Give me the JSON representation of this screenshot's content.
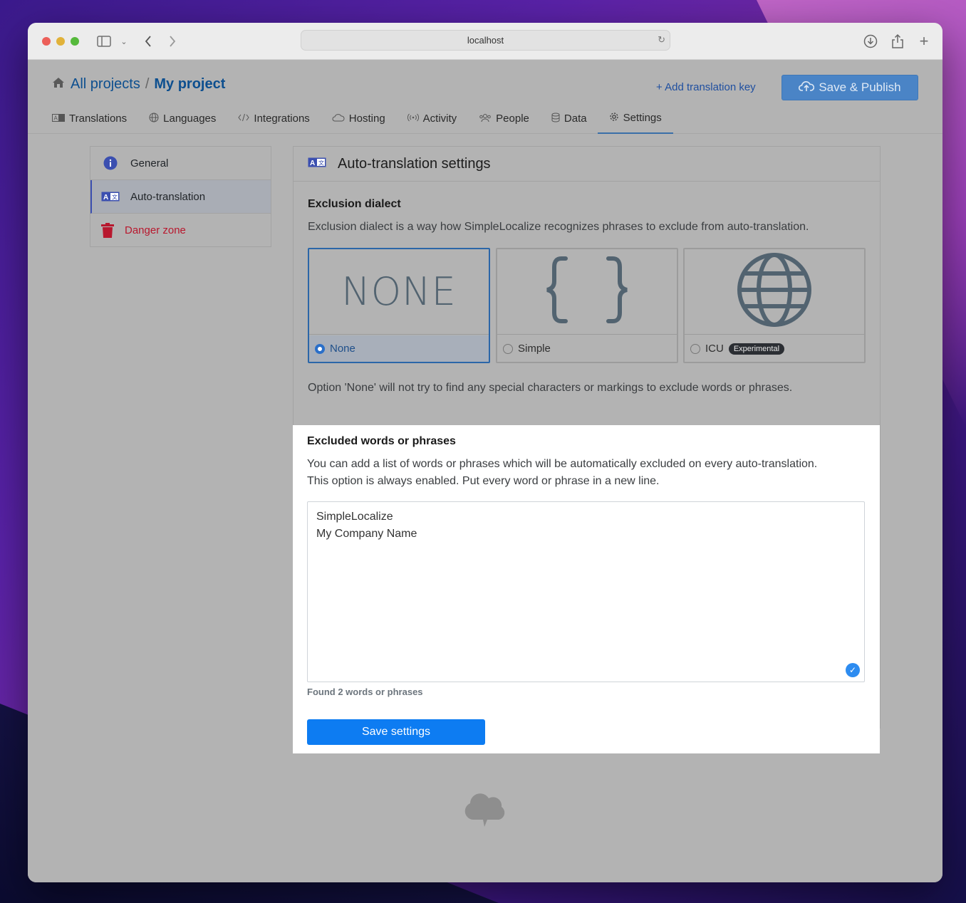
{
  "browser": {
    "url": "localhost"
  },
  "header": {
    "breadcrumb_all": "All projects",
    "breadcrumb_sep": "/",
    "breadcrumb_project": "My project",
    "add_key": "+ Add translation key",
    "publish": "Save & Publish"
  },
  "tabs": [
    {
      "label": "Translations",
      "icon": "translate-icon"
    },
    {
      "label": "Languages",
      "icon": "globe-icon"
    },
    {
      "label": "Integrations",
      "icon": "code-icon"
    },
    {
      "label": "Hosting",
      "icon": "cloud-icon"
    },
    {
      "label": "Activity",
      "icon": "broadcast-icon"
    },
    {
      "label": "People",
      "icon": "people-icon"
    },
    {
      "label": "Data",
      "icon": "database-icon"
    },
    {
      "label": "Settings",
      "icon": "gear-icon"
    }
  ],
  "sidebar": {
    "items": [
      {
        "label": "General",
        "icon": "info-icon"
      },
      {
        "label": "Auto-translation",
        "icon": "translate-icon"
      },
      {
        "label": "Danger zone",
        "icon": "trash-icon"
      }
    ]
  },
  "panel": {
    "title": "Auto-translation settings",
    "dialect_heading": "Exclusion dialect",
    "dialect_desc": "Exclusion dialect is a way how SimpleLocalize recognizes phrases to exclude from auto-translation.",
    "options": [
      {
        "label": "None",
        "image_text": "NONE",
        "selected": true
      },
      {
        "label": "Simple",
        "image_text": "{ }",
        "selected": false
      },
      {
        "label": "ICU",
        "badge": "Experimental",
        "selected": false
      }
    ],
    "option_note": "Option 'None' will not try to find any special characters or markings to exclude words or phrases.",
    "excluded_heading": "Excluded words or phrases",
    "excluded_desc_1": "You can add a list of words or phrases which will be automatically excluded on every auto-translation.",
    "excluded_desc_2": "This option is always enabled. Put every word or phrase in a new line.",
    "excluded_lines": [
      "SimpleLocalize",
      "My Company Name"
    ],
    "found": "Found 2 words or phrases",
    "save": "Save settings"
  },
  "colors": {
    "primary": "#0d7cf2",
    "danger": "#b8182e",
    "link": "#0d4f8f"
  }
}
